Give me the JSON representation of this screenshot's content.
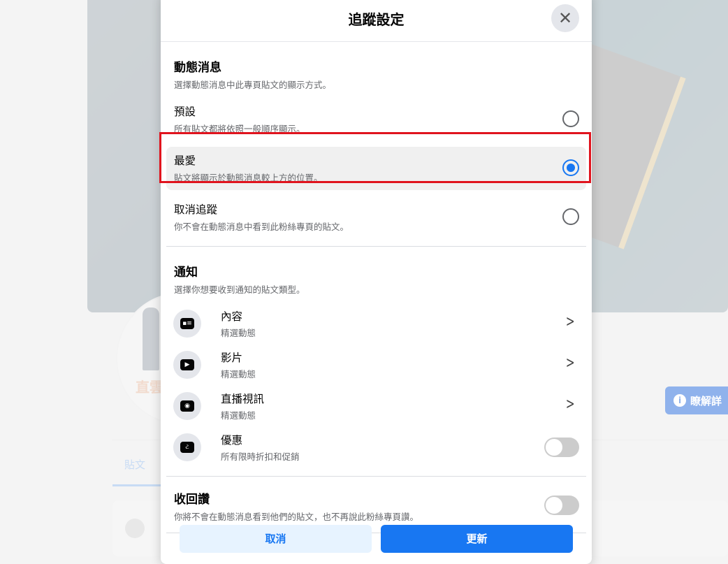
{
  "background": {
    "tab_posts": "貼文",
    "learn_more": "瞭解詳",
    "avatar_text": "直雲"
  },
  "modal": {
    "title": "追蹤設定",
    "feed": {
      "title": "動態消息",
      "subtitle": "選擇動態消息中此專頁貼文的顯示方式。",
      "options": [
        {
          "label": "預設",
          "desc": "所有貼文都將依照一般順序顯示。",
          "selected": false
        },
        {
          "label": "最愛",
          "desc": "貼文將顯示於動態消息較上方的位置。",
          "selected": true
        },
        {
          "label": "取消追蹤",
          "desc": "你不會在動態消息中看到此粉絲專頁的貼文。",
          "selected": false
        }
      ]
    },
    "notifications": {
      "title": "通知",
      "subtitle": "選擇你想要收到通知的貼文類型。",
      "items": [
        {
          "label": "內容",
          "desc": "精選動態",
          "icon": "chat-bubble-icon",
          "control": "chevron"
        },
        {
          "label": "影片",
          "desc": "精選動態",
          "icon": "video-play-icon",
          "control": "chevron"
        },
        {
          "label": "直播視訊",
          "desc": "精選動態",
          "icon": "live-video-icon",
          "control": "chevron"
        },
        {
          "label": "優惠",
          "desc": "所有限時折扣和促銷",
          "icon": "offer-icon",
          "control": "toggle",
          "on": false
        }
      ]
    },
    "unlike": {
      "title": "收回讚",
      "desc": "你將不會在動態消息看到他們的貼文，也不再說此粉絲專頁讚。",
      "on": false
    },
    "cancel_label": "取消",
    "update_label": "更新"
  },
  "colors": {
    "accent": "#1877f2",
    "highlight": "#e0141e"
  }
}
